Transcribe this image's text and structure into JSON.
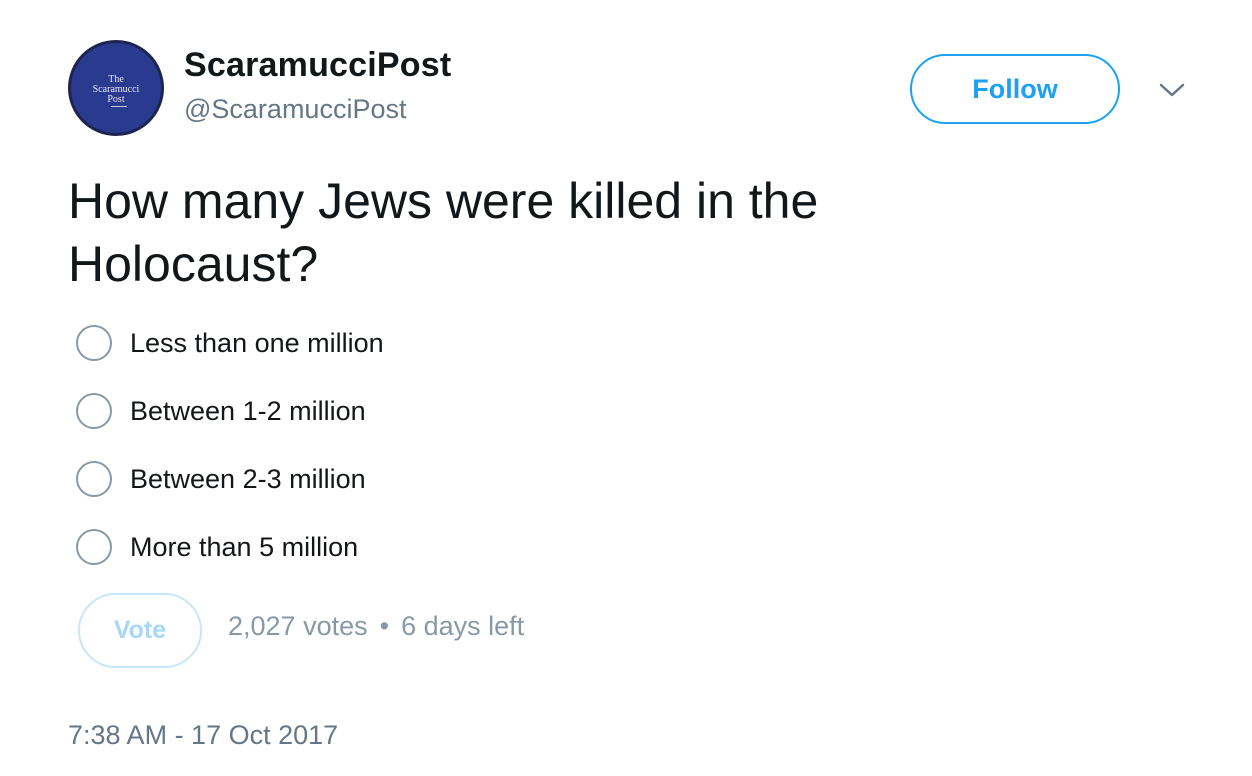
{
  "author": {
    "display_name": "ScaramucciPost",
    "handle": "@ScaramucciPost",
    "avatar_logo_lines": [
      "The",
      "Scaramucci",
      "Post"
    ],
    "avatar_color": "#2a3b8f"
  },
  "actions": {
    "follow_label": "Follow",
    "more_icon": "chevron-down-icon"
  },
  "tweet": {
    "question": "How many Jews were killed in the Holocaust?",
    "timestamp": "7:38 AM - 17 Oct 2017"
  },
  "poll": {
    "options": [
      {
        "label": "Less than one million"
      },
      {
        "label": "Between 1-2 million"
      },
      {
        "label": "Between 2-3 million"
      },
      {
        "label": "More than 5 million"
      }
    ],
    "vote_label": "Vote",
    "votes": "2,027 votes",
    "separator": "•",
    "time_left": "6 days left"
  },
  "colors": {
    "accent": "#1da1f2",
    "text": "#14171a",
    "muted": "#657786",
    "vote_disabled": "#a8d7f8"
  }
}
